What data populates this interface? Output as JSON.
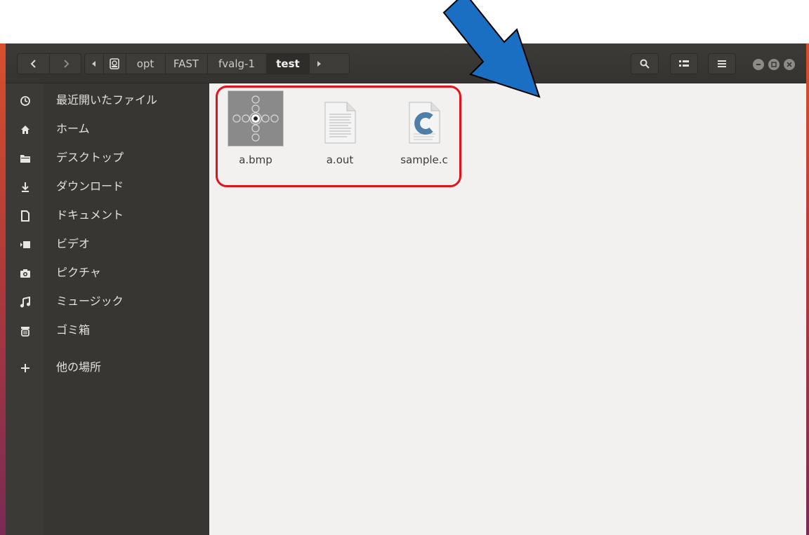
{
  "window": {
    "title": "test",
    "accent": "#e1141c"
  },
  "toolbar": {
    "back_icon": "chevron-left-icon",
    "forward_icon": "chevron-right-icon",
    "search_icon": "search-icon",
    "view_toggle_icon": "grid-view-icon",
    "menu_icon": "hamburger-icon"
  },
  "pathbar": {
    "items": [
      "opt",
      "FAST",
      "fvalg-1",
      "test"
    ],
    "root_icon": "drive-icon"
  },
  "sidebar": {
    "items": [
      {
        "label": "最近開いたファイル",
        "icon": "clock-icon"
      },
      {
        "label": "ホーム",
        "icon": "home-icon"
      },
      {
        "label": "デスクトップ",
        "icon": "folder-icon"
      },
      {
        "label": "ダウンロード",
        "icon": "download-icon"
      },
      {
        "label": "ドキュメント",
        "icon": "document-icon"
      },
      {
        "label": "ビデオ",
        "icon": "video-icon"
      },
      {
        "label": "ピクチャ",
        "icon": "camera-icon"
      },
      {
        "label": "ミュージック",
        "icon": "music-icon"
      },
      {
        "label": "ゴミ箱",
        "icon": "trash-icon"
      },
      {
        "label": "他の場所",
        "icon": "plus-icon"
      }
    ]
  },
  "files": [
    {
      "name": "a.bmp",
      "icon": "image-thumbnail-icon"
    },
    {
      "name": "a.out",
      "icon": "text-file-icon"
    },
    {
      "name": "sample.c",
      "icon": "c-source-file-icon"
    }
  ]
}
